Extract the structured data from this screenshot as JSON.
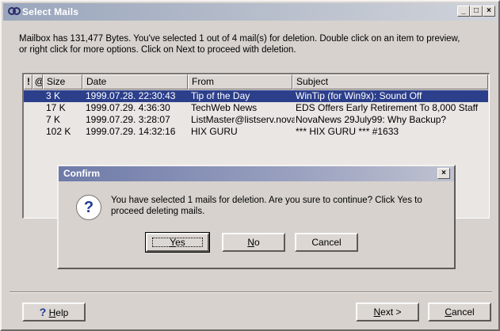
{
  "window": {
    "title": "Select Mails",
    "controls": {
      "minimize": "_",
      "maximize": "□",
      "close": "×"
    }
  },
  "intro": {
    "line1": "Mailbox has 131,477 Bytes.  You've selected 1 out of 4 mail(s) for deletion.  Double click on an item to preview,",
    "line2": "or right click for more options. Click on Next to proceed with deletion."
  },
  "list": {
    "columns": [
      "!",
      "@",
      "Size",
      "Date",
      "From",
      "Subject"
    ],
    "rows": [
      {
        "size": "3 K",
        "date": "1999.07.28. 22:30:43",
        "from": "Tip of the Day",
        "subject": "WinTip (for Win9x): Sound Off",
        "selected": true
      },
      {
        "size": "17 K",
        "date": "1999.07.29. 4:36:30",
        "from": "TechWeb News",
        "subject": "EDS Offers Early Retirement To 8,000 Staff",
        "selected": false
      },
      {
        "size": "7 K",
        "date": "1999.07.29. 3:28:07",
        "from": "ListMaster@listserv.nova",
        "subject": "NovaNews 29July99: Why Backup?",
        "selected": false
      },
      {
        "size": "102 K",
        "date": "1999.07.29. 14:32:16",
        "from": "HIX GURU",
        "subject": "*** HIX GURU *** #1633",
        "selected": false
      }
    ]
  },
  "confirm": {
    "title": "Confirm",
    "close": "×",
    "message": "You have selected 1 mails for deletion.  Are you sure to continue? Click Yes to proceed deleting mails.",
    "icon": "question-icon",
    "yes": {
      "mnemonic": "Y",
      "rest": "es"
    },
    "no": {
      "mnemonic": "N",
      "rest": "o"
    },
    "cancel": "Cancel"
  },
  "footer": {
    "help": {
      "mnemonic": "H",
      "rest": "elp"
    },
    "next": {
      "mnemonic": "N",
      "rest": "ext >"
    },
    "cancel": {
      "mnemonic": "C",
      "rest": "ancel"
    }
  },
  "colors": {
    "selection": "#2c3f8b",
    "face": "#d7d2ce",
    "accent": "#1f3a93"
  }
}
